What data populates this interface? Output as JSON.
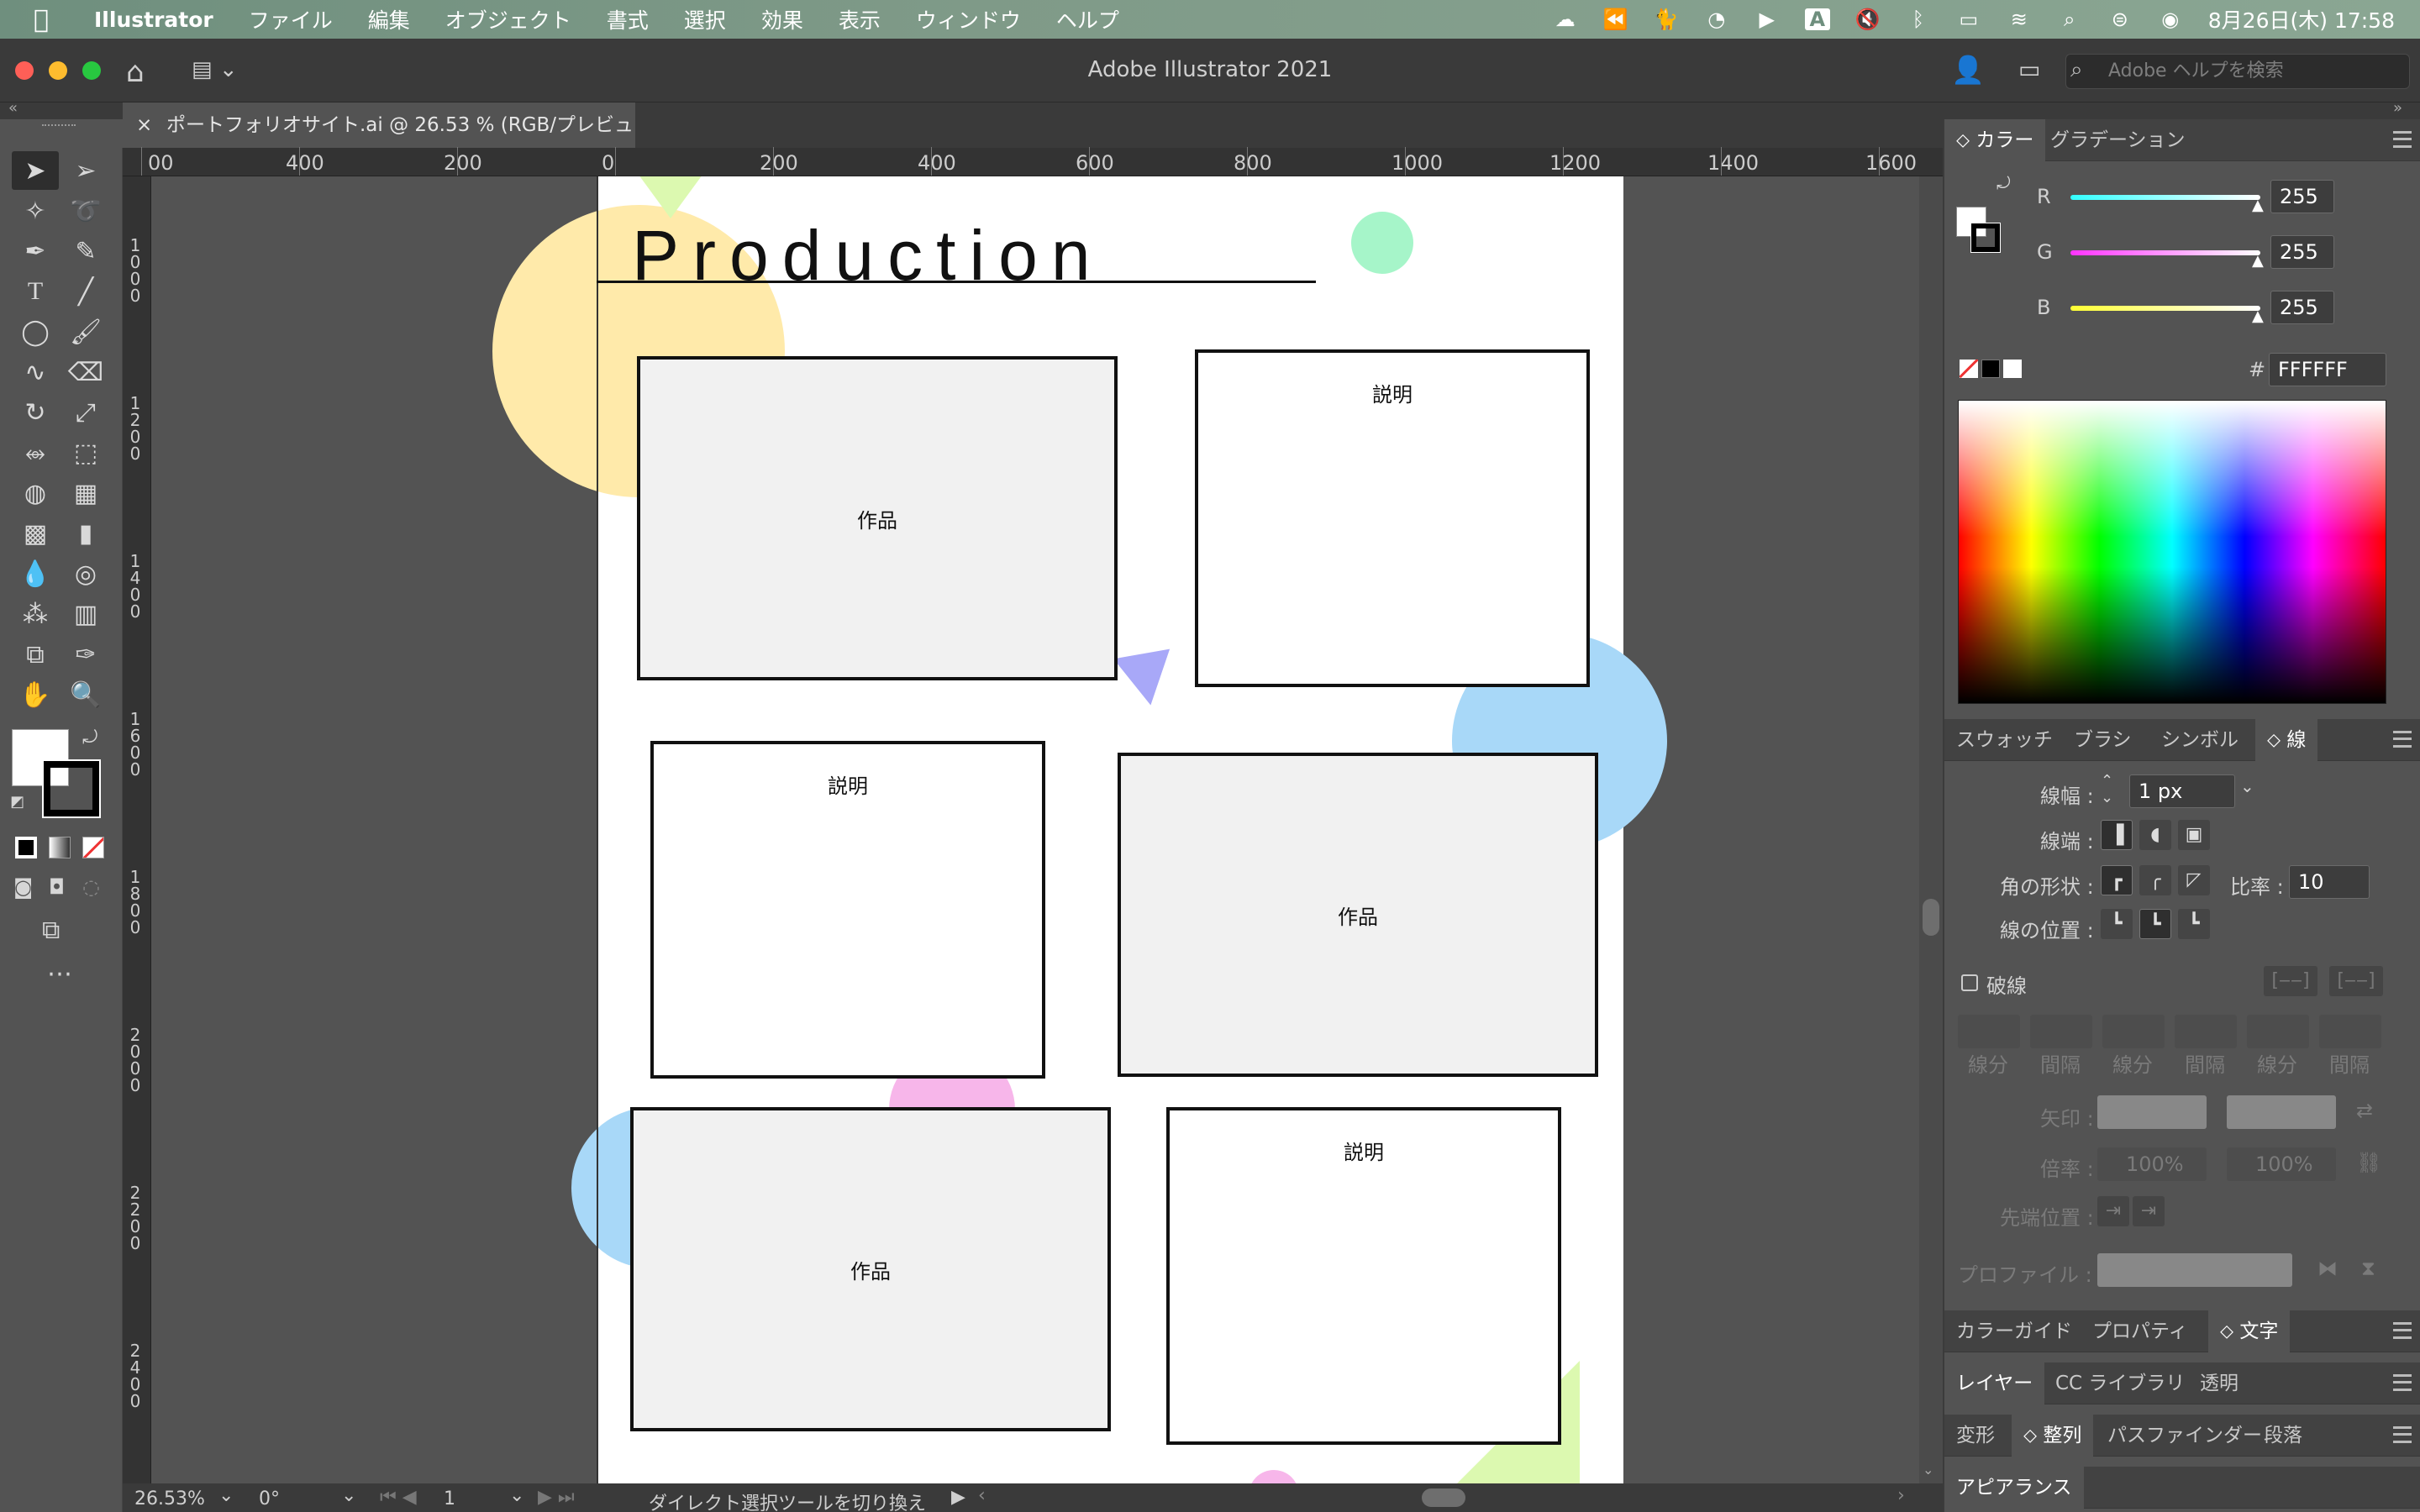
{
  "menubar": {
    "app_name": "Illustrator",
    "items": [
      "ファイル",
      "編集",
      "オブジェクト",
      "書式",
      "選択",
      "効果",
      "表示",
      "ウィンドウ",
      "ヘルプ"
    ],
    "clock": "8月26日(木)  17:58",
    "input_mode": "A"
  },
  "window": {
    "title": "Adobe Illustrator 2021",
    "help_search_placeholder": "Adobe ヘルプを検索"
  },
  "document_tab": {
    "title": "ポートフォリオサイト.ai @ 26.53 % (RGB/プレビュー)",
    "close": "×"
  },
  "ruler": {
    "horizontal": [
      "00",
      "400",
      "200",
      "0",
      "200",
      "400",
      "600",
      "800",
      "1000",
      "1200",
      "1400",
      "1600"
    ],
    "vertical": [
      "1000",
      "1200",
      "1400",
      "1600",
      "1800",
      "2000",
      "2200",
      "2400"
    ]
  },
  "artboard": {
    "heading": "Production",
    "cards": [
      {
        "kind": "work",
        "label": "作品"
      },
      {
        "kind": "desc",
        "label": "説明"
      },
      {
        "kind": "desc",
        "label": "説明"
      },
      {
        "kind": "work",
        "label": "作品"
      },
      {
        "kind": "work",
        "label": "作品"
      },
      {
        "kind": "desc",
        "label": "説明"
      }
    ],
    "colors": {
      "yellow_circle": "#ffeaaa",
      "green_circle": "#a6f5c9",
      "blue_circle": "#a8d8f8",
      "pink_circle": "#f7b6ea",
      "purple_triangle": "#a8a8f8",
      "lime_triangle": "#dcf9b0"
    }
  },
  "color_panel": {
    "tabs": [
      "カラー",
      "グラデーション"
    ],
    "r_label": "R",
    "g_label": "G",
    "b_label": "B",
    "r": "255",
    "g": "255",
    "b": "255",
    "hex_label": "#",
    "hex": "FFFFFF"
  },
  "stroke_panel": {
    "tabs": [
      "スウォッチ",
      "ブラシ",
      "シンボル",
      "線"
    ],
    "weight_label": "線幅 :",
    "weight_value": "1 px",
    "cap_label": "線端 :",
    "corner_label": "角の形状 :",
    "limit_label": "比率 :",
    "limit_value": "10",
    "align_label": "線の位置 :",
    "dashed_label": "破線",
    "dash_labels": [
      "線分",
      "間隔",
      "線分",
      "間隔",
      "線分",
      "間隔"
    ],
    "arrow_label": "矢印 :",
    "scale_label": "倍率 :",
    "scale_value": "100%",
    "align_arrow_label": "先端位置 :",
    "profile_label": "プロファイル :"
  },
  "bottom_panels": {
    "row1": [
      "カラーガイド",
      "プロパティ",
      "文字"
    ],
    "row2": [
      "レイヤー",
      "CC ライブラリ",
      "透明"
    ],
    "row3": [
      "変形",
      "整列",
      "パスファインダー",
      "段落"
    ],
    "row4": [
      "アピアランス"
    ]
  },
  "statusbar": {
    "zoom": "26.53%",
    "rotation": "0°",
    "artboard_number": "1",
    "tool_hint": "ダイレクト選択ツールを切り換え"
  }
}
